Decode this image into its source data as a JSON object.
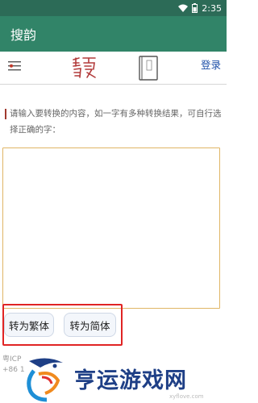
{
  "status_bar": {
    "time": "2:35",
    "icons": [
      "wifi-icon",
      "battery-icon"
    ]
  },
  "app_bar": {
    "title": "搜韵"
  },
  "header": {
    "menu_icon": "menu-icon",
    "logo_icon": "souyun-seal-logo",
    "book_icon": "book-icon",
    "login_label": "登录"
  },
  "instruction": {
    "text": "请输入要转换的内容，如一字有多种转换结果，可自行选择正确的字："
  },
  "editor": {
    "value": "",
    "placeholder": ""
  },
  "buttons": {
    "to_traditional": "转为繁体",
    "to_simplified": "转为简体"
  },
  "footer": {
    "icp_text": "粤ICP",
    "phone_text": "+86 1"
  },
  "watermark": {
    "text": "亨运游戏网",
    "url": "xyflove.com"
  },
  "colors": {
    "status_bar": "#2c6b57",
    "app_bar": "#318468",
    "login_link": "#1d4fa8",
    "text_area_border": "#e0b565",
    "highlight": "#e02424",
    "watermark_text": "#1e3f86"
  }
}
